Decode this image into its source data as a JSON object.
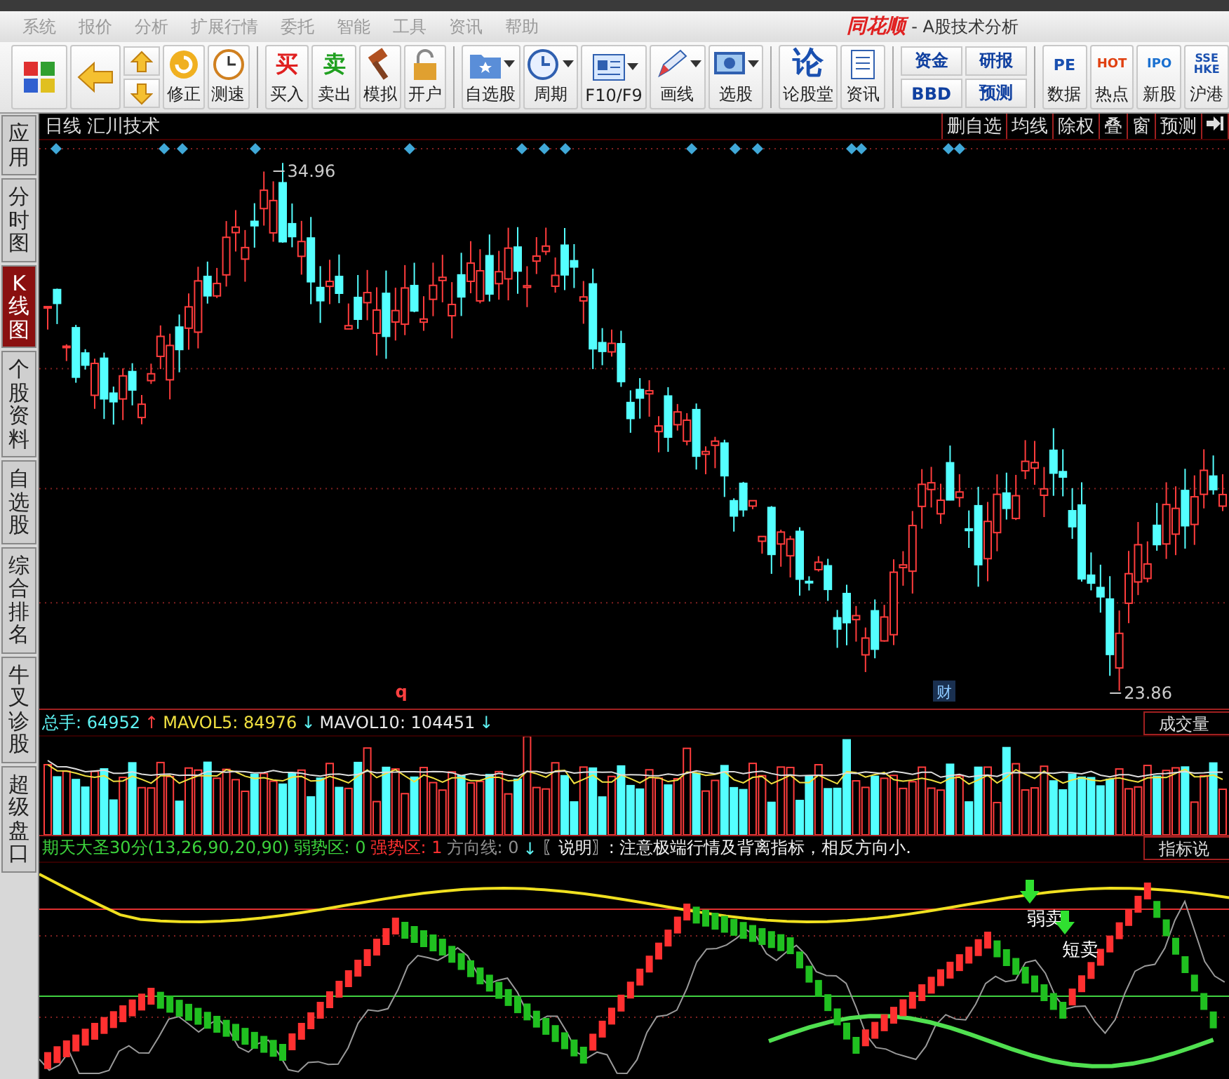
{
  "menu": [
    {
      "label": "系统"
    },
    {
      "label": "报价"
    },
    {
      "label": "分析"
    },
    {
      "label": "扩展行情"
    },
    {
      "label": "委托"
    },
    {
      "label": "智能"
    },
    {
      "label": "工具"
    },
    {
      "label": "资讯"
    },
    {
      "label": "帮助"
    }
  ],
  "app_title": {
    "logo": "同花顺",
    "subtitle": "- A股技术分析"
  },
  "toolbar": [
    {
      "kind": "tile"
    },
    {
      "kind": "tile"
    },
    {
      "kind": "stack"
    },
    {
      "kind": "icon",
      "label": "修正"
    },
    {
      "kind": "icon",
      "label": "测速"
    },
    {
      "kind": "glyph",
      "glyph": "买",
      "label": "买入"
    },
    {
      "kind": "glyph",
      "glyph": "卖",
      "label": "卖出"
    },
    {
      "kind": "icon",
      "label": "模拟"
    },
    {
      "kind": "icon",
      "label": "开户"
    },
    {
      "kind": "dropdown",
      "label": "自选股"
    },
    {
      "kind": "dropdown",
      "label": "周期"
    },
    {
      "kind": "dropdown",
      "label": "F10/F9"
    },
    {
      "kind": "dropdown",
      "label": "画线"
    },
    {
      "kind": "dropdown",
      "label": "选股"
    },
    {
      "kind": "glyph",
      "glyph": "论",
      "label": "论股堂"
    },
    {
      "kind": "icon",
      "label": "资讯"
    },
    {
      "kind": "pair",
      "labels": [
        "资金",
        "BBD"
      ]
    },
    {
      "kind": "pair",
      "labels": [
        "研报",
        "预测"
      ]
    },
    {
      "kind": "glyph",
      "glyph": "PE",
      "label": "数据"
    },
    {
      "kind": "glyph",
      "glyph": "HOT",
      "label": "热点"
    },
    {
      "kind": "glyph",
      "glyph": "IPO",
      "label": "新股"
    },
    {
      "kind": "glyph",
      "glyph": "SSE HKE",
      "label": "沪港"
    }
  ],
  "side_tabs": [
    {
      "label": "应用",
      "selected": false
    },
    {
      "label": "分时图",
      "selected": false
    },
    {
      "label": "K线图",
      "selected": true
    },
    {
      "label": "个股资料",
      "selected": false
    },
    {
      "label": "自选股",
      "selected": false
    },
    {
      "label": "综合排名",
      "selected": false
    },
    {
      "label": "牛叉诊股",
      "selected": false
    },
    {
      "label": "超级盘口",
      "selected": false
    }
  ],
  "chart_header": {
    "period": "日线",
    "stock": "汇川技术",
    "buttons": [
      {
        "label": "删自选"
      },
      {
        "label": "均线"
      },
      {
        "label": "除权"
      },
      {
        "label": "叠"
      },
      {
        "label": "窗"
      },
      {
        "label": "预测"
      }
    ]
  },
  "price_chart": {
    "high_label": "34.96",
    "low_label": "23.86",
    "markers": [
      {
        "text": "q",
        "kind": "plain"
      },
      {
        "text": "财",
        "kind": "boxed"
      }
    ]
  },
  "volume": {
    "fields": [
      {
        "text": "总手: 64952",
        "kind": "total"
      },
      {
        "text": "↑",
        "kind": "up"
      },
      {
        "text": "MAVOL5: 84976",
        "kind": "ma5"
      },
      {
        "text": "↓",
        "kind": "down"
      },
      {
        "text": "MAVOL10: 104451",
        "kind": "ma10"
      },
      {
        "text": "↓",
        "kind": "down"
      }
    ],
    "button": "成交量"
  },
  "indicator": {
    "fields": [
      {
        "text": "期天大圣30分(13,26,90,20,90)",
        "kind": "name"
      },
      {
        "text": "弱势区: 0",
        "kind": "weak"
      },
      {
        "text": "强势区: 1",
        "kind": "strong"
      },
      {
        "text": "方向线: 0",
        "kind": "direction"
      },
      {
        "text": "↓",
        "kind": "down"
      },
      {
        "text": "〖说明〗: 注意极端行情及背离指标，相反方向小.",
        "kind": "note"
      }
    ],
    "button": "指标说",
    "signals": [
      {
        "text": "弱卖"
      },
      {
        "text": "短卖"
      }
    ]
  }
}
